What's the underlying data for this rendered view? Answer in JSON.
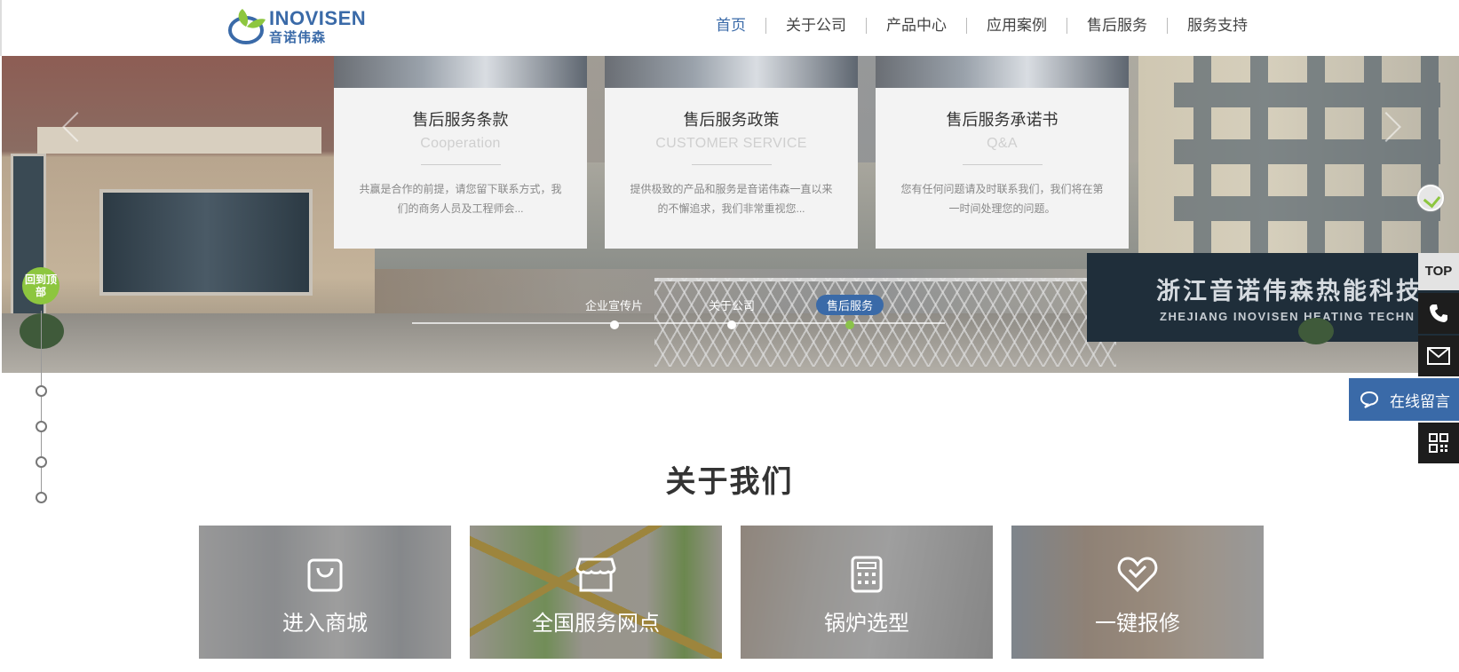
{
  "brand": {
    "name_en": "INOVISEN",
    "name_cn": "音诺伟森"
  },
  "nav": [
    {
      "label": "首页",
      "active": true
    },
    {
      "label": "关于公司",
      "active": false
    },
    {
      "label": "产品中心",
      "active": false
    },
    {
      "label": "应用案例",
      "active": false
    },
    {
      "label": "售后服务",
      "active": false
    },
    {
      "label": "服务支持",
      "active": false
    }
  ],
  "banner": {
    "sign_cn": "浙江音诺伟森热能科技",
    "sign_en": "ZHEJIANG INOVISEN HEATING TECHN",
    "cards": [
      {
        "title": "售后服务条款",
        "subtitle": "Cooperation",
        "desc": "共赢是合作的前提，请您留下联系方式，我们的商务人员及工程师会..."
      },
      {
        "title": "售后服务政策",
        "subtitle": "CUSTOMER SERVICE",
        "desc": "提供极致的产品和服务是音诺伟森一直以来的不懈追求，我们非常重视您..."
      },
      {
        "title": "售后服务承诺书",
        "subtitle": "Q&A",
        "desc": "您有任何问题请及时联系我们，我们将在第一时间处理您的问题。"
      }
    ],
    "timeline": [
      {
        "label": "企业宣传片",
        "active": false
      },
      {
        "label": "关于公司",
        "active": false
      },
      {
        "label": "售后服务",
        "active": true
      }
    ]
  },
  "side_nav": {
    "back_top": "回到顶部"
  },
  "float_bar": {
    "top": "TOP",
    "message": "在线留言"
  },
  "about": {
    "title": "关于我们",
    "tiles": [
      {
        "label": "进入商城",
        "icon": "bag-icon"
      },
      {
        "label": "全国服务网点",
        "icon": "shop-icon"
      },
      {
        "label": "锅炉选型",
        "icon": "calculator-icon"
      },
      {
        "label": "一键报修",
        "icon": "heart-icon"
      }
    ]
  },
  "colors": {
    "brand_blue": "#3a6aa8",
    "brand_green": "#8dc63f"
  }
}
